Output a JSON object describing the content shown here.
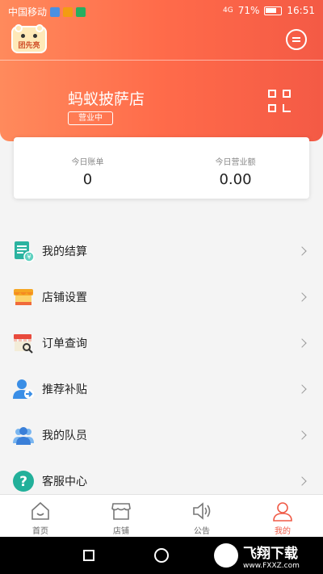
{
  "status_bar": {
    "carrier": "中国移动",
    "battery": "71%",
    "time": "16:51",
    "network": "4G"
  },
  "header": {
    "logo_text": "团先亮",
    "store_name": "蚂蚁披萨店",
    "store_status": "营业中"
  },
  "stats": {
    "bills_label": "今日账单",
    "bills_value": "0",
    "revenue_label": "今日营业额",
    "revenue_value": "0.00"
  },
  "menu": [
    {
      "label": "我的结算",
      "icon": "settlement-icon"
    },
    {
      "label": "店铺设置",
      "icon": "store-settings-icon"
    },
    {
      "label": "订单查询",
      "icon": "order-search-icon"
    },
    {
      "label": "推荐补贴",
      "icon": "referral-icon"
    },
    {
      "label": "我的队员",
      "icon": "team-icon"
    },
    {
      "label": "客服中心",
      "icon": "help-icon"
    }
  ],
  "bottom_nav": [
    {
      "label": "首页",
      "icon": "home-icon"
    },
    {
      "label": "店铺",
      "icon": "shop-icon"
    },
    {
      "label": "公告",
      "icon": "speaker-icon"
    },
    {
      "label": "我的",
      "icon": "profile-icon",
      "active": true
    }
  ],
  "watermark": {
    "text": "飞翔下载",
    "url": "www.FXXZ.com"
  },
  "colors": {
    "accent": "#f05a46",
    "header_start": "#ff8a5c",
    "header_end": "#f45a45"
  }
}
